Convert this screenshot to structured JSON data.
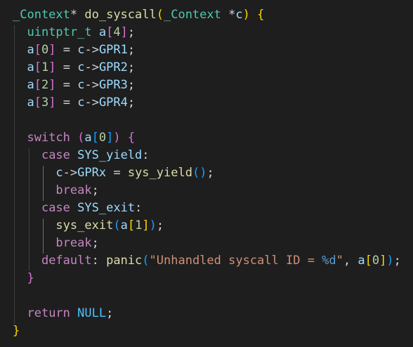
{
  "editor": {
    "colors": {
      "background": "#1e1e1e",
      "keyword": "#569cd6",
      "control": "#c586c0",
      "type": "#4ec9b0",
      "function": "#dcdcaa",
      "variable": "#9cdcfe",
      "number": "#b5cea8",
      "string": "#ce9178",
      "bracket1": "#ffd700",
      "bracket2": "#da70d6",
      "bracket3": "#179fff"
    },
    "lines": [
      [
        [
          "type",
          "_Context"
        ],
        [
          "plain",
          "* "
        ],
        [
          "fn",
          "do_syscall"
        ],
        [
          "b1",
          "("
        ],
        [
          "type",
          "_Context"
        ],
        [
          "plain",
          " *"
        ],
        [
          "var",
          "c"
        ],
        [
          "b1",
          ")"
        ],
        [
          "plain",
          " "
        ],
        [
          "b1",
          "{"
        ]
      ],
      [
        [
          "plain",
          "  "
        ],
        [
          "type",
          "uintptr_t"
        ],
        [
          "plain",
          " "
        ],
        [
          "var",
          "a"
        ],
        [
          "b2",
          "["
        ],
        [
          "num",
          "4"
        ],
        [
          "b2",
          "]"
        ],
        [
          "plain",
          ";"
        ]
      ],
      [
        [
          "plain",
          "  "
        ],
        [
          "var",
          "a"
        ],
        [
          "b2",
          "["
        ],
        [
          "num",
          "0"
        ],
        [
          "b2",
          "]"
        ],
        [
          "plain",
          " = "
        ],
        [
          "var",
          "c"
        ],
        [
          "plain",
          "->"
        ],
        [
          "var",
          "GPR1"
        ],
        [
          "plain",
          ";"
        ]
      ],
      [
        [
          "plain",
          "  "
        ],
        [
          "var",
          "a"
        ],
        [
          "b2",
          "["
        ],
        [
          "num",
          "1"
        ],
        [
          "b2",
          "]"
        ],
        [
          "plain",
          " = "
        ],
        [
          "var",
          "c"
        ],
        [
          "plain",
          "->"
        ],
        [
          "var",
          "GPR2"
        ],
        [
          "plain",
          ";"
        ]
      ],
      [
        [
          "plain",
          "  "
        ],
        [
          "var",
          "a"
        ],
        [
          "b2",
          "["
        ],
        [
          "num",
          "2"
        ],
        [
          "b2",
          "]"
        ],
        [
          "plain",
          " = "
        ],
        [
          "var",
          "c"
        ],
        [
          "plain",
          "->"
        ],
        [
          "var",
          "GPR3"
        ],
        [
          "plain",
          ";"
        ]
      ],
      [
        [
          "plain",
          "  "
        ],
        [
          "var",
          "a"
        ],
        [
          "b2",
          "["
        ],
        [
          "num",
          "3"
        ],
        [
          "b2",
          "]"
        ],
        [
          "plain",
          " = "
        ],
        [
          "var",
          "c"
        ],
        [
          "plain",
          "->"
        ],
        [
          "var",
          "GPR4"
        ],
        [
          "plain",
          ";"
        ]
      ],
      [],
      [
        [
          "plain",
          "  "
        ],
        [
          "ctrl",
          "switch"
        ],
        [
          "plain",
          " "
        ],
        [
          "b2",
          "("
        ],
        [
          "var",
          "a"
        ],
        [
          "b3",
          "["
        ],
        [
          "num",
          "0"
        ],
        [
          "b3",
          "]"
        ],
        [
          "b2",
          ")"
        ],
        [
          "plain",
          " "
        ],
        [
          "b2",
          "{"
        ]
      ],
      [
        [
          "plain",
          "    "
        ],
        [
          "ctrl",
          "case"
        ],
        [
          "plain",
          " "
        ],
        [
          "var",
          "SYS_yield"
        ],
        [
          "plain",
          ":"
        ]
      ],
      [
        [
          "plain",
          "      "
        ],
        [
          "var",
          "c"
        ],
        [
          "plain",
          "->"
        ],
        [
          "var",
          "GPRx"
        ],
        [
          "plain",
          " = "
        ],
        [
          "fn",
          "sys_yield"
        ],
        [
          "b3",
          "()"
        ],
        [
          "plain",
          ";"
        ]
      ],
      [
        [
          "plain",
          "      "
        ],
        [
          "ctrl",
          "break"
        ],
        [
          "plain",
          ";"
        ]
      ],
      [
        [
          "plain",
          "    "
        ],
        [
          "ctrl",
          "case"
        ],
        [
          "plain",
          " "
        ],
        [
          "var",
          "SYS_exit"
        ],
        [
          "plain",
          ":"
        ]
      ],
      [
        [
          "plain",
          "      "
        ],
        [
          "fn",
          "sys_exit"
        ],
        [
          "b3",
          "("
        ],
        [
          "var",
          "a"
        ],
        [
          "b1",
          "["
        ],
        [
          "num",
          "1"
        ],
        [
          "b1",
          "]"
        ],
        [
          "b3",
          ")"
        ],
        [
          "plain",
          ";"
        ]
      ],
      [
        [
          "plain",
          "      "
        ],
        [
          "ctrl",
          "break"
        ],
        [
          "plain",
          ";"
        ]
      ],
      [
        [
          "plain",
          "    "
        ],
        [
          "ctrl",
          "default"
        ],
        [
          "plain",
          ": "
        ],
        [
          "fn",
          "panic"
        ],
        [
          "b3",
          "("
        ],
        [
          "str",
          "\"Unhandled syscall ID = "
        ],
        [
          "esc",
          "%d"
        ],
        [
          "str",
          "\""
        ],
        [
          "plain",
          ", "
        ],
        [
          "var",
          "a"
        ],
        [
          "b1",
          "["
        ],
        [
          "num",
          "0"
        ],
        [
          "b1",
          "]"
        ],
        [
          "b3",
          ")"
        ],
        [
          "plain",
          ";"
        ]
      ],
      [
        [
          "plain",
          "  "
        ],
        [
          "b2",
          "}"
        ]
      ],
      [],
      [
        [
          "plain",
          "  "
        ],
        [
          "ctrl",
          "return"
        ],
        [
          "plain",
          " "
        ],
        [
          "const",
          "NULL"
        ],
        [
          "plain",
          ";"
        ]
      ],
      [
        [
          "b1",
          "}"
        ]
      ]
    ]
  }
}
